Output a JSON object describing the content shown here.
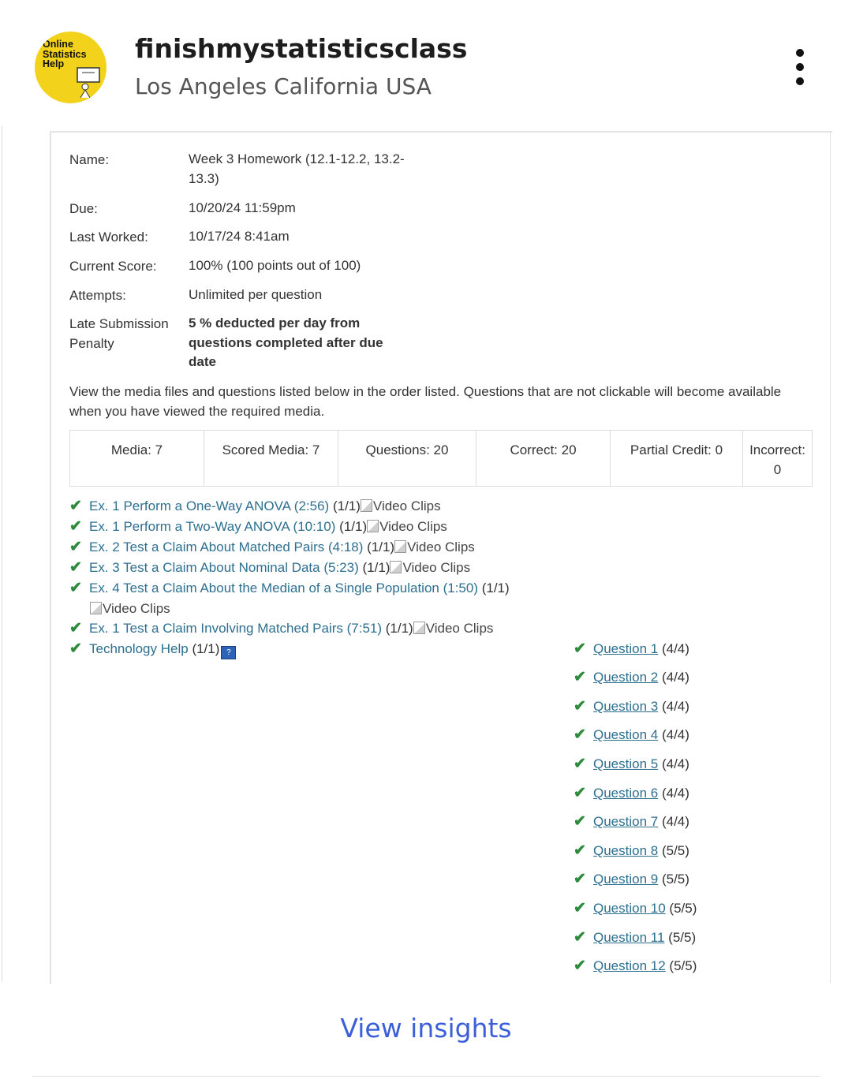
{
  "post": {
    "account_name": "finishmystatisticsclass",
    "location": "Los Angeles California USA",
    "avatar_text": [
      "Online",
      "Statistics",
      "Help"
    ],
    "view_insights": "View insights"
  },
  "assignment": {
    "details": [
      {
        "label": "Name:",
        "value": "Week 3 Homework (12.1-12.2, 13.2-13.3)"
      },
      {
        "label": "Due:",
        "value": "10/20/24 11:59pm"
      },
      {
        "label": "Last Worked:",
        "value": "10/17/24 8:41am"
      },
      {
        "label": "Current Score:",
        "value": "100% (100 points out of 100)"
      },
      {
        "label": "Attempts:",
        "value": "Unlimited per question"
      },
      {
        "label": "Late Submission Penalty",
        "value": "5 % deducted per day from questions completed after due date"
      }
    ],
    "instructions": "View the media files and questions listed below in the order listed.  Questions that are not clickable will become available when you have viewed the required media.",
    "summary": [
      "Media: 7",
      "Scored Media: 7",
      "Questions: 20",
      "Correct: 20",
      "Partial Credit: 0",
      "Incorrect: 0"
    ],
    "media": [
      {
        "title": "Ex. 1 Perform a One-Way ANOVA (2:56)",
        "score": "(1/1)",
        "extra": "Video Clips"
      },
      {
        "title": "Ex. 1 Perform a Two-Way ANOVA (10:10)",
        "score": "(1/1)",
        "extra": "Video Clips"
      },
      {
        "title": "Ex. 2 Test a Claim About Matched Pairs (4:18)",
        "score": "(1/1)",
        "extra": "Video Clips"
      },
      {
        "title": "Ex. 3 Test a Claim About Nominal Data (5:23)",
        "score": "(1/1)",
        "extra": "Video Clips"
      },
      {
        "title": "Ex. 4 Test a Claim About the Median of a Single Population (1:50)",
        "score": "(1/1)",
        "extra": "Video Clips"
      },
      {
        "title": "Ex. 1 Test a Claim Involving Matched Pairs (7:51)",
        "score": "(1/1)",
        "extra": "Video Clips"
      },
      {
        "title": "Technology Help",
        "score": "(1/1)",
        "extra": ""
      }
    ],
    "questions": [
      {
        "label": "Question 1",
        "score": "(4/4)"
      },
      {
        "label": "Question 2",
        "score": "(4/4)"
      },
      {
        "label": "Question 3",
        "score": "(4/4)"
      },
      {
        "label": "Question 4",
        "score": "(4/4)"
      },
      {
        "label": "Question 5",
        "score": "(4/4)"
      },
      {
        "label": "Question 6",
        "score": "(4/4)"
      },
      {
        "label": "Question 7",
        "score": "(4/4)"
      },
      {
        "label": "Question 8",
        "score": "(5/5)"
      },
      {
        "label": "Question 9",
        "score": "(5/5)"
      },
      {
        "label": "Question 10",
        "score": "(5/5)"
      },
      {
        "label": "Question 11",
        "score": "(5/5)"
      },
      {
        "label": "Question 12",
        "score": "(5/5)"
      }
    ],
    "check_glyph": "✔"
  }
}
